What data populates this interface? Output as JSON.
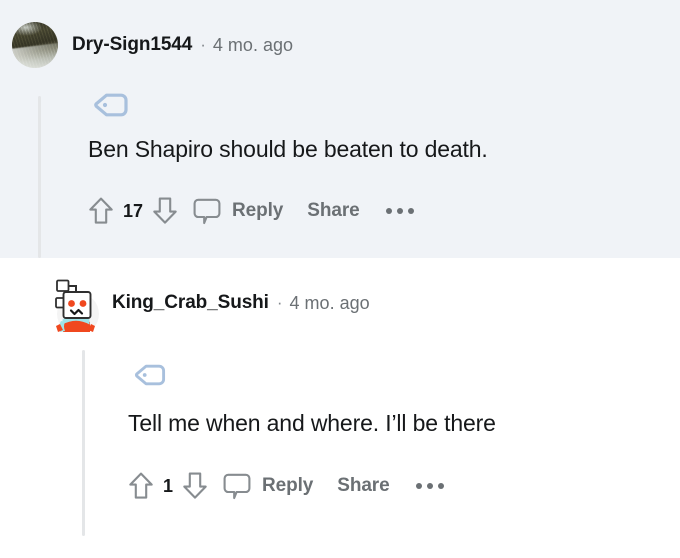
{
  "theme": {
    "highlight_background": "#f0f3f7",
    "page_background": "#ffffff",
    "text_color": "#16181a",
    "muted_color": "#6b7074",
    "thread_line_color": "#e4e6e8",
    "tag_icon_color": "#a8c0dd",
    "snoo_orange": "#f0481f",
    "snoo_scarf": "#9fe3e8"
  },
  "comments": [
    {
      "id": "comment-parent",
      "highlighted": true,
      "avatar": "photo-avatar",
      "username": "Dry-Sign1544",
      "separator": "·",
      "timestamp": "4 mo. ago",
      "tag_icon": "tag-icon",
      "body": "Ben Shapiro should be beaten to death.",
      "actions": {
        "upvote_icon": "upvote-arrow-icon",
        "score": "17",
        "downvote_icon": "downvote-arrow-icon",
        "comment_icon": "comment-bubble-icon",
        "reply_label": "Reply",
        "share_label": "Share",
        "more_icon": "more-options-icon"
      }
    },
    {
      "id": "comment-child",
      "highlighted": false,
      "avatar": "snoo-avatar",
      "username": "King_Crab_Sushi",
      "separator": "·",
      "timestamp": "4 mo. ago",
      "tag_icon": "tag-icon",
      "body": "Tell me when and where. I’ll be there",
      "actions": {
        "upvote_icon": "upvote-arrow-icon",
        "score": "1",
        "downvote_icon": "downvote-arrow-icon",
        "comment_icon": "comment-bubble-icon",
        "reply_label": "Reply",
        "share_label": "Share",
        "more_icon": "more-options-icon"
      }
    }
  ]
}
